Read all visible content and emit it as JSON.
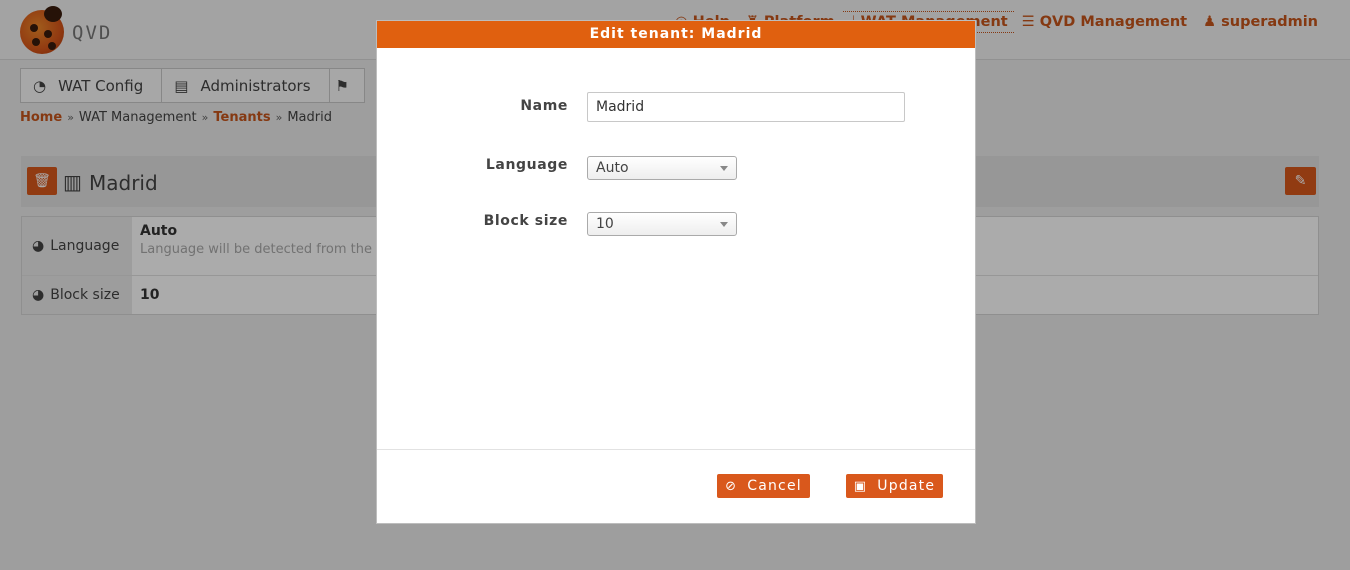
{
  "app": {
    "logo_text": "QVD"
  },
  "topnav": {
    "help": "Help",
    "platform": "Platform",
    "wat_management": "WAT Management",
    "qvd_management": "QVD Management",
    "user": "superadmin"
  },
  "menu": {
    "items": [
      {
        "label": "WAT Config"
      },
      {
        "label": "Administrators"
      }
    ]
  },
  "breadcrumb": {
    "home": "Home",
    "wat_management": "WAT Management",
    "tenants": "Tenants",
    "current": "Madrid"
  },
  "page": {
    "title": "Madrid",
    "rows": [
      {
        "label": "Language",
        "value": "Auto",
        "sub": "Language will be detected from the"
      },
      {
        "label": "Block size",
        "value": "10"
      }
    ]
  },
  "modal": {
    "title": "Edit tenant: Madrid",
    "fields": {
      "name_label": "Name",
      "name_value": "Madrid",
      "language_label": "Language",
      "language_value": "Auto",
      "block_size_label": "Block size",
      "block_size_value": "10"
    },
    "cancel_label": "Cancel",
    "update_label": "Update"
  },
  "colors": {
    "accent": "#d9581c",
    "header": "#e0600f"
  },
  "icons": [
    "help-icon",
    "platform-icon",
    "wat-management-icon",
    "qvd-management-icon",
    "user-icon",
    "dashboard-icon",
    "briefcase-icon",
    "trash-icon",
    "building-icon",
    "pencil-icon",
    "globe-icon",
    "ban-icon",
    "save-icon"
  ]
}
